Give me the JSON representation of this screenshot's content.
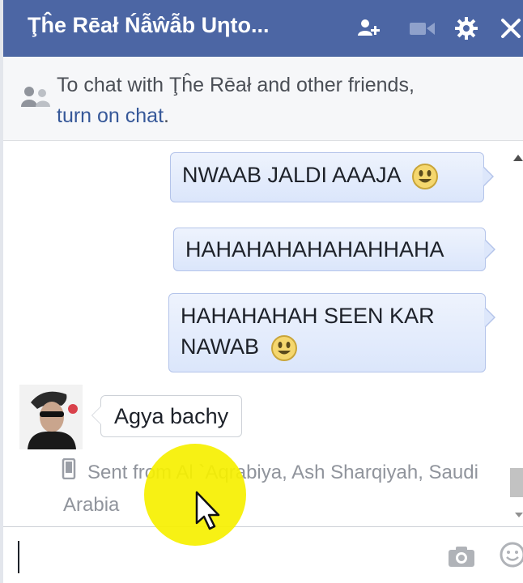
{
  "header": {
    "title": "Ţĥe Rēał Ńẫŵẫb Uηto...",
    "background": "#4c66a4"
  },
  "notice": {
    "prefix": "To chat with Ţĥe Rēał and other friends,",
    "link": "turn on chat",
    "suffix": "."
  },
  "messages": {
    "outgoing": [
      {
        "text": "NWAAB JALDI AAAJA",
        "emoji": "smile"
      },
      {
        "text": "HAHAHAHAHAHAHHAHA",
        "emoji": ""
      },
      {
        "text_line1": "HAHAHAHAH SEEN KAR",
        "text_line2": "NAWAB",
        "emoji": "smile"
      }
    ],
    "incoming": {
      "text": "Agya bachy"
    },
    "sent_from": "Sent from Al `Aqrabiya, Ash Sharqiyah, Saudi Arabia"
  },
  "icons": [
    "add-friend-icon",
    "video-call-icon",
    "gear-icon",
    "close-icon",
    "friends-icon",
    "mobile-icon",
    "camera-icon",
    "emoji-icon",
    "mouse-cursor-icon"
  ],
  "colors": {
    "bubble": "#dbe6fb",
    "link": "#365899",
    "highlight": "#f6f000"
  }
}
